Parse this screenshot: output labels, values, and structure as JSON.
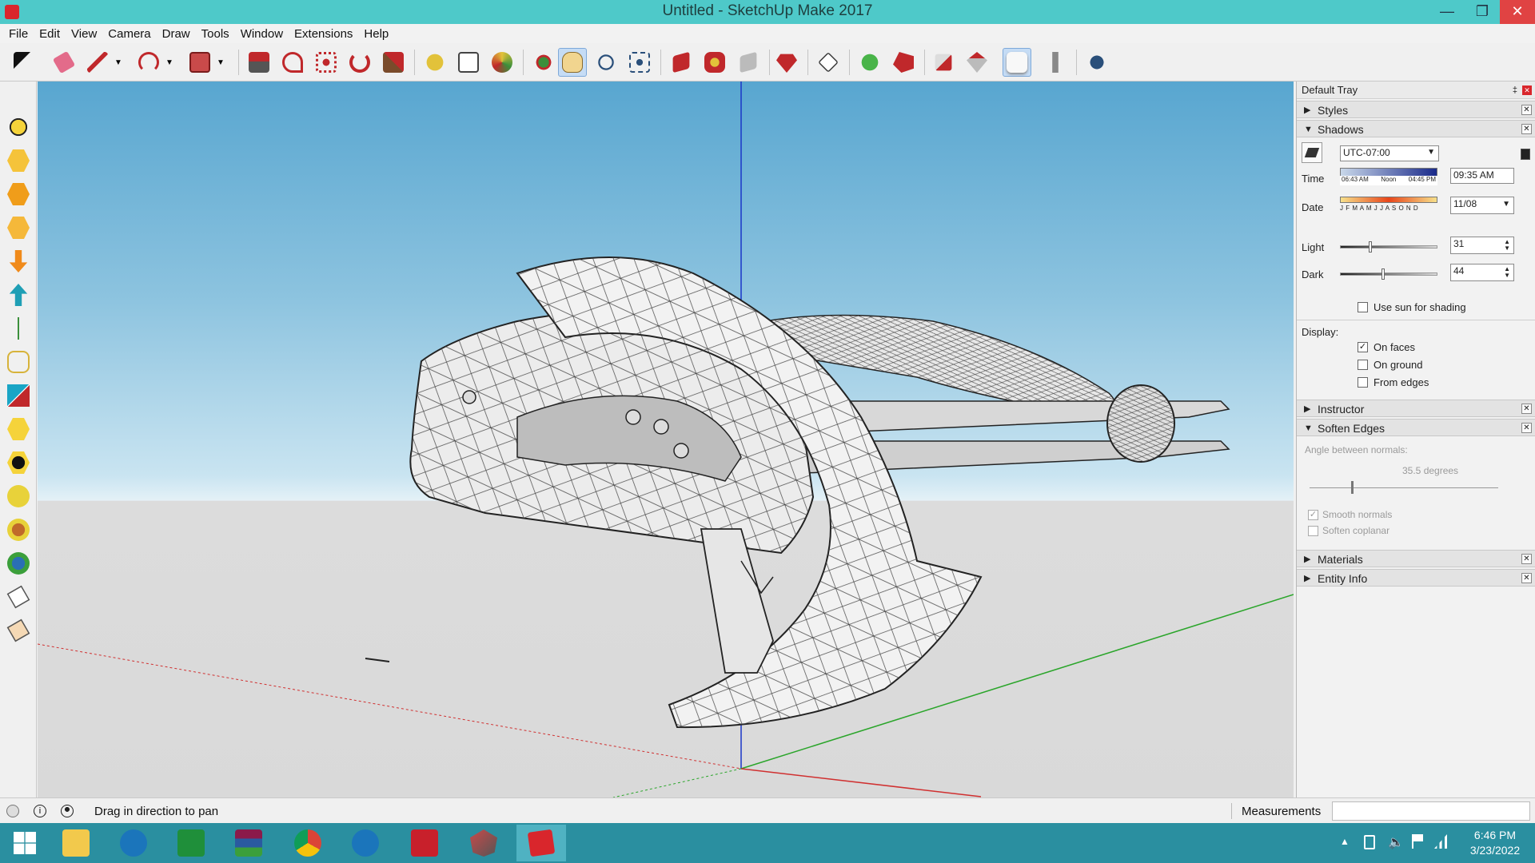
{
  "window": {
    "title": "Untitled - SketchUp Make 2017"
  },
  "menu": [
    "File",
    "Edit",
    "View",
    "Camera",
    "Draw",
    "Tools",
    "Window",
    "Extensions",
    "Help"
  ],
  "tray": {
    "title": "Default Tray",
    "panels": {
      "styles": "Styles",
      "shadows": "Shadows",
      "instructor": "Instructor",
      "soften_edges": "Soften Edges",
      "materials": "Materials",
      "entity_info": "Entity Info"
    },
    "shadows": {
      "timezone": "UTC-07:00",
      "time_label": "Time",
      "time_value": "09:35 AM",
      "time_ticks": [
        "06:43 AM",
        "Noon",
        "04:45 PM"
      ],
      "date_label": "Date",
      "date_value": "11/08",
      "months": "J F M A M J J A S O N D",
      "light_label": "Light",
      "light_value": "31",
      "light_fraction": 0.31,
      "dark_label": "Dark",
      "dark_value": "44",
      "dark_fraction": 0.44,
      "use_sun_label": "Use sun for shading",
      "display_label": "Display:",
      "on_faces": "On faces",
      "on_ground": "On ground",
      "from_edges": "From edges"
    },
    "soften": {
      "angle_label": "Angle between normals:",
      "angle_value": "35.5  degrees",
      "smooth_normals": "Smooth normals",
      "soften_coplanar": "Soften coplanar"
    }
  },
  "status": {
    "hint": "Drag in direction to pan",
    "measurements_label": "Measurements"
  },
  "clock": {
    "time": "6:46 PM",
    "date": "3/23/2022"
  },
  "colors": {
    "titlebar": "#4ec9c9",
    "taskbar": "#2a8fa0",
    "sky": "#58a6d0",
    "ground": "#d9d9d9"
  }
}
